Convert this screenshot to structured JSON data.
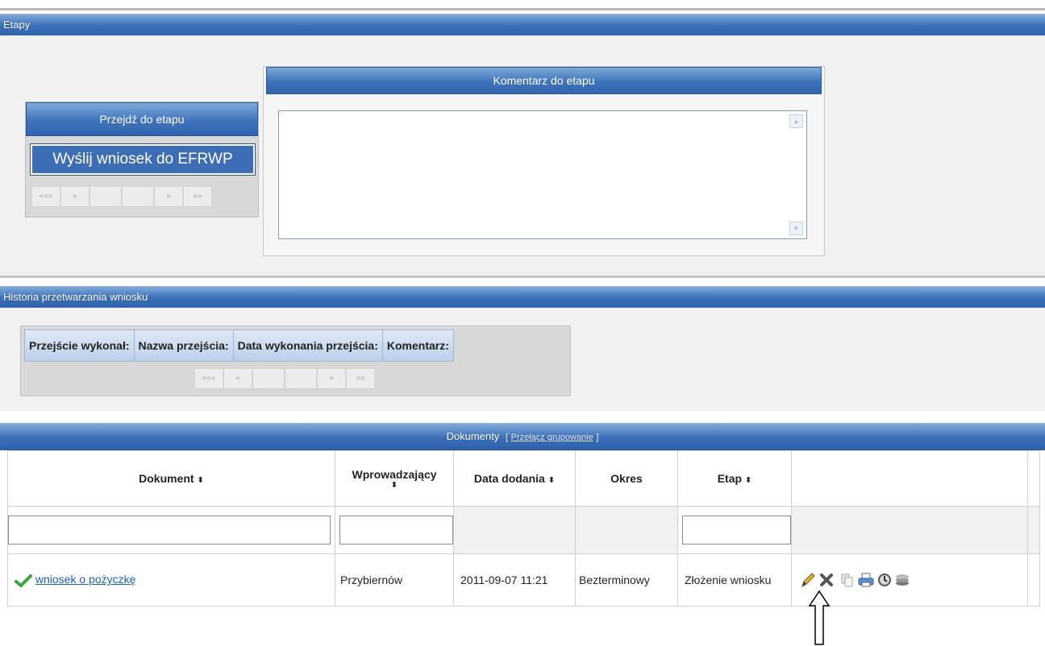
{
  "etapy_bar": {
    "title": "Etapy"
  },
  "stage": {
    "header": "Przejdź do etapu",
    "button_label": "Wyślij wniosek do EFRWP",
    "pager": [
      "«««",
      "«",
      "",
      "",
      "»",
      "»»"
    ]
  },
  "comment": {
    "header": "Komentarz do etapu",
    "value": ""
  },
  "history_bar": {
    "title": "Historia przetwarzania wniosku"
  },
  "history": {
    "columns": [
      "Przejście wykonał:",
      "Nazwa przejścia:",
      "Data wykonania przejścia:",
      "Komentarz:"
    ],
    "pager": [
      "«««",
      "«",
      "",
      "",
      "»",
      "»»"
    ]
  },
  "documents_bar": {
    "title": "Dokumenty",
    "toggle_open": "[",
    "toggle_link": "Przełącz grupowanie",
    "toggle_close": "]"
  },
  "documents": {
    "columns": {
      "document": "Dokument",
      "introducer": "Wprowadzający",
      "date_added": "Data dodania",
      "period": "Okres",
      "stage": "Etap"
    },
    "sort_glyph": "⬍",
    "rows": [
      {
        "document": "wniosek o pożyczkę",
        "introducer": "Przybiernów",
        "date_added": "2011-09-07 11:21",
        "period": "Bezterminowy",
        "stage": "Złożenie wniosku",
        "status": "check-icon"
      }
    ],
    "actions": [
      "edit-icon",
      "delete-icon",
      "copy-icon",
      "print-icon",
      "history-icon",
      "stack-icon"
    ]
  },
  "colors": {
    "header_blue": "#3c6fb8",
    "panel_gray": "#f1f1f1",
    "link": "#1a5fb4",
    "check_green": "#3aa53a",
    "delete_gray": "#555555"
  }
}
